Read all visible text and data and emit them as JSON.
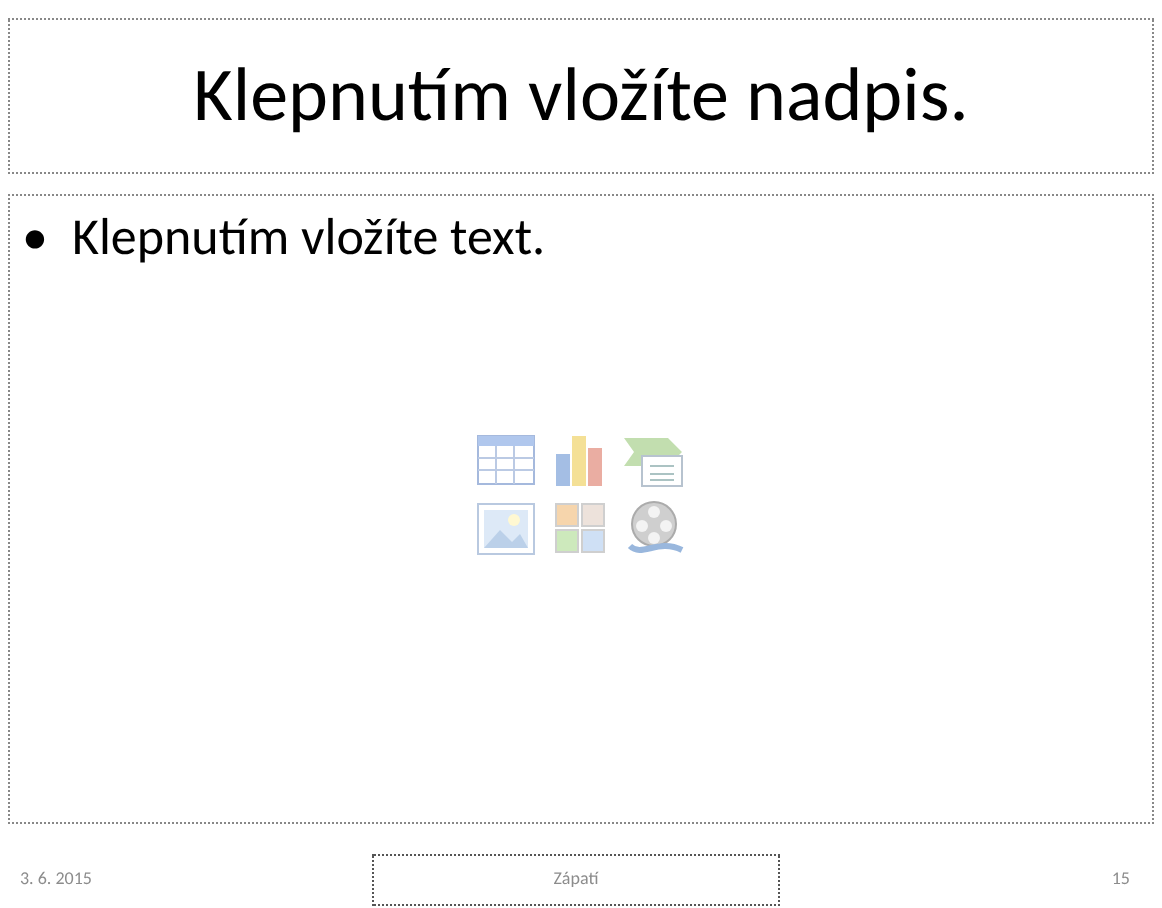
{
  "title_placeholder": "Klepnutím vložíte nadpis.",
  "body_placeholder": {
    "bullet": "•",
    "text": "Klepnutím vložíte text."
  },
  "footer": {
    "date": "3. 6. 2015",
    "center": "Zápatí",
    "page_number": "15"
  }
}
